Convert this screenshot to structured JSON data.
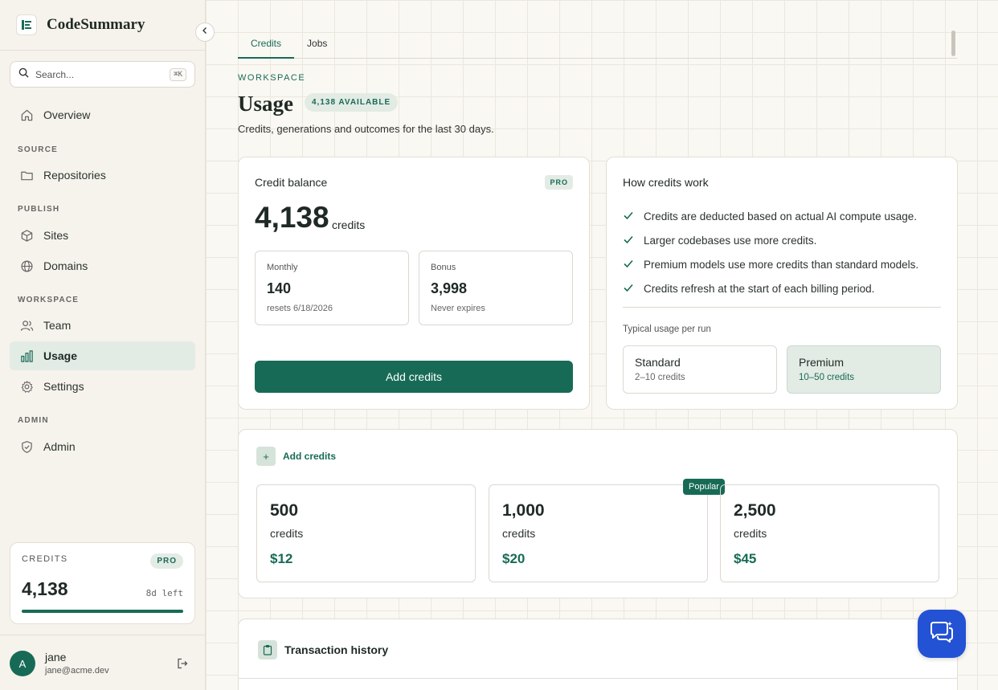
{
  "app": {
    "name": "CodeSummary"
  },
  "search": {
    "placeholder": "Search...",
    "shortcut": "⌘K"
  },
  "nav": {
    "overview": "Overview",
    "source_label": "SOURCE",
    "repositories": "Repositories",
    "publish_label": "PUBLISH",
    "sites": "Sites",
    "domains": "Domains",
    "workspace_label": "WORKSPACE",
    "team": "Team",
    "usage": "Usage",
    "settings": "Settings",
    "admin_label": "ADMIN",
    "admin": "Admin"
  },
  "sidebar_credits": {
    "label": "CREDITS",
    "plan": "PRO",
    "value": "4,138",
    "remaining": "8d left",
    "progress_fraction": 1.0
  },
  "user": {
    "initial": "A",
    "name": "jane",
    "email": "jane@acme.dev"
  },
  "tabs": [
    {
      "label": "Credits"
    },
    {
      "label": "Jobs"
    }
  ],
  "header": {
    "eyebrow": "WORKSPACE",
    "title": "Usage",
    "badge": "4,138 AVAILABLE",
    "subtitle": "Credits, generations and outcomes for the last 30 days."
  },
  "balance": {
    "title": "Credit balance",
    "plan": "PRO",
    "value": "4,138",
    "unit": "credits",
    "monthly": {
      "label": "Monthly",
      "value": "140",
      "note": "resets 6/18/2026"
    },
    "bonus": {
      "label": "Bonus",
      "value": "3,998",
      "note": "Never expires"
    },
    "button": "Add credits"
  },
  "how": {
    "title": "How credits work",
    "points": [
      "Credits are deducted based on actual AI compute usage.",
      "Larger codebases use more credits.",
      "Premium models use more credits than standard models.",
      "Credits refresh at the start of each billing period."
    ],
    "typical_label": "Typical usage per run",
    "standard": {
      "name": "Standard",
      "range": "2–10 credits"
    },
    "premium": {
      "name": "Premium",
      "range": "10–50 credits"
    }
  },
  "packs": {
    "title": "Add credits",
    "popular_label": "Popular",
    "items": [
      {
        "amount": "500",
        "unit": "credits",
        "price": "$12"
      },
      {
        "amount": "1,000",
        "unit": "credits",
        "price": "$20"
      },
      {
        "amount": "2,500",
        "unit": "credits",
        "price": "$45"
      }
    ]
  },
  "transactions": {
    "title": "Transaction history"
  },
  "colors": {
    "accent": "#176b56",
    "accent_light": "#e3ebe5",
    "chat": "#2452d4"
  },
  "icons": {
    "logo": "document-lines-icon",
    "search": "search-icon",
    "overview": "home-icon",
    "repositories": "folder-icon",
    "sites": "cube-icon",
    "domains": "globe-icon",
    "team": "users-icon",
    "usage": "bar-chart-icon",
    "settings": "gear-icon",
    "admin": "shield-check-icon",
    "logout": "logout-icon",
    "collapse": "chevron-left-icon",
    "check": "check-icon",
    "plus": "plus-icon",
    "clipboard": "clipboard-icon",
    "chat": "chat-bubbles-icon"
  }
}
